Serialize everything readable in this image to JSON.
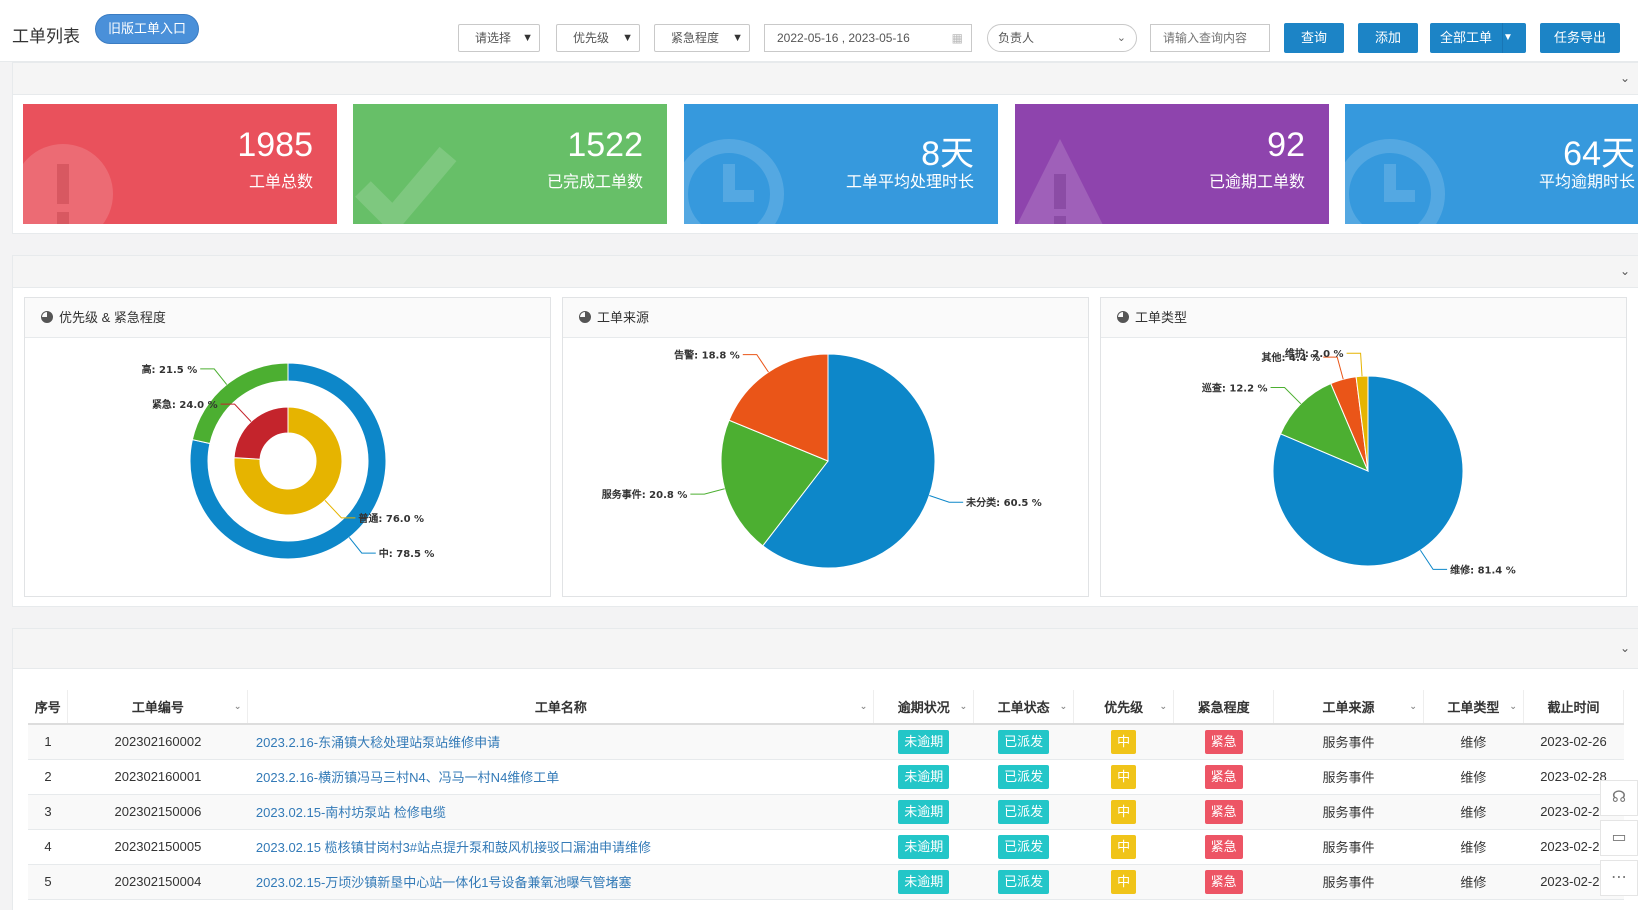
{
  "header": {
    "title": "工单列表",
    "old_entry": "旧版工单入口",
    "filters": [
      {
        "label": "请选择"
      },
      {
        "label": "优先级"
      },
      {
        "label": "紧急程度"
      }
    ],
    "date_range": "2022-05-16 , 2023-05-16",
    "owner_placeholder": "负责人",
    "search_placeholder": "请输入查询内容",
    "buttons": {
      "query": "查询",
      "add": "添加",
      "all": "全部工单",
      "export": "任务导出"
    }
  },
  "stats": [
    {
      "value": "1985",
      "label": "工单总数",
      "color": "#e9515c",
      "icon": "exclamation-icon"
    },
    {
      "value": "1522",
      "label": "已完成工单数",
      "color": "#67bf68",
      "icon": "check-icon"
    },
    {
      "value": "8天",
      "label": "工单平均处理时长",
      "color": "#3699dd",
      "icon": "clock-icon"
    },
    {
      "value": "92",
      "label": "已逾期工单数",
      "color": "#8e44ad",
      "icon": "warning-icon"
    },
    {
      "value": "64天",
      "label": "平均逾期时长",
      "color": "#3699dd",
      "icon": "clock-icon"
    }
  ],
  "charts": {
    "titles": [
      "优先级 & 紧急程度",
      "工单来源",
      "工单类型"
    ]
  },
  "chart_data": [
    {
      "type": "pie",
      "title": "优先级 & 紧急程度",
      "rings": [
        {
          "name": "outer",
          "slices": [
            {
              "label": "中",
              "value": 78.5,
              "color": "#0d87c9"
            },
            {
              "label": "高",
              "value": 21.5,
              "color": "#4caf31"
            }
          ]
        },
        {
          "name": "inner",
          "slices": [
            {
              "label": "普通",
              "value": 76.0,
              "color": "#e6b400"
            },
            {
              "label": "紧急",
              "value": 24.0,
              "color": "#c4242c"
            }
          ]
        }
      ]
    },
    {
      "type": "pie",
      "title": "工单来源",
      "slices": [
        {
          "label": "未分类",
          "value": 60.5,
          "color": "#0d87c9"
        },
        {
          "label": "服务事件",
          "value": 20.8,
          "color": "#4caf31"
        },
        {
          "label": "告警",
          "value": 18.8,
          "color": "#ea5518"
        }
      ]
    },
    {
      "type": "pie",
      "title": "工单类型",
      "slices": [
        {
          "label": "维修",
          "value": 81.4,
          "color": "#0d87c9"
        },
        {
          "label": "巡查",
          "value": 12.2,
          "color": "#4caf31"
        },
        {
          "label": "其他",
          "value": 4.4,
          "color": "#ea5518"
        },
        {
          "label": "维护",
          "value": 2.0,
          "color": "#e6b400"
        }
      ]
    }
  ],
  "table": {
    "columns": [
      "序号",
      "工单编号",
      "工单名称",
      "逾期状况",
      "工单状态",
      "优先级",
      "紧急程度",
      "工单来源",
      "工单类型",
      "截止时间"
    ],
    "rows": [
      {
        "idx": "1",
        "code": "202302160002",
        "name": "2023.2.16-东涌镇大稔处理站泵站维修申请",
        "overdue": "未逾期",
        "status": "已派发",
        "priority": "中",
        "urgency": "紧急",
        "source": "服务事件",
        "type": "维修",
        "deadline": "2023-02-26"
      },
      {
        "idx": "2",
        "code": "202302160001",
        "name": "2023.2.16-横沥镇冯马三村N4、冯马一村N4维修工单",
        "overdue": "未逾期",
        "status": "已派发",
        "priority": "中",
        "urgency": "紧急",
        "source": "服务事件",
        "type": "维修",
        "deadline": "2023-02-28"
      },
      {
        "idx": "3",
        "code": "202302150006",
        "name": "2023.02.15-南村坊泵站 检修电缆",
        "overdue": "未逾期",
        "status": "已派发",
        "priority": "中",
        "urgency": "紧急",
        "source": "服务事件",
        "type": "维修",
        "deadline": "2023-02-25"
      },
      {
        "idx": "4",
        "code": "202302150005",
        "name": "2023.02.15 榄核镇甘岗村3#站点提升泵和鼓风机接驳口漏油申请维修",
        "overdue": "未逾期",
        "status": "已派发",
        "priority": "中",
        "urgency": "紧急",
        "source": "服务事件",
        "type": "维修",
        "deadline": "2023-02-25"
      },
      {
        "idx": "5",
        "code": "202302150004",
        "name": "2023.02.15-万顷沙镇新垦中心站一体化1号设备兼氧池曝气管堵塞",
        "overdue": "未逾期",
        "status": "已派发",
        "priority": "中",
        "urgency": "紧急",
        "source": "服务事件",
        "type": "维修",
        "deadline": "2023-02-25"
      }
    ]
  },
  "tag_colors": {
    "overdue": "#23c6c8",
    "status": "#23c6c8",
    "priority": "#f0c419",
    "urgency": "#ed5565"
  }
}
